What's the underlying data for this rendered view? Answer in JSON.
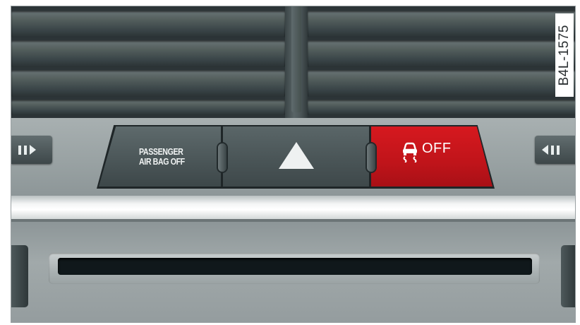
{
  "figure": {
    "code": "B4L-1575"
  },
  "switch_panel": {
    "airbag_button": {
      "line1": "PASSENGER",
      "line2": "AIR BAG OFF"
    },
    "hazard_button": {
      "icon": "hazard-triangle-icon"
    },
    "esc_button": {
      "icon": "esc-car-skid-icon",
      "label": "OFF",
      "color": "#c8151b"
    }
  },
  "side_controls": {
    "left": {
      "icon": "vent-wheel-right-icon"
    },
    "right": {
      "icon": "vent-wheel-left-icon"
    }
  },
  "colors": {
    "vent": "#2c3437",
    "panel": "#4a5557",
    "esc_red": "#c8151b"
  }
}
